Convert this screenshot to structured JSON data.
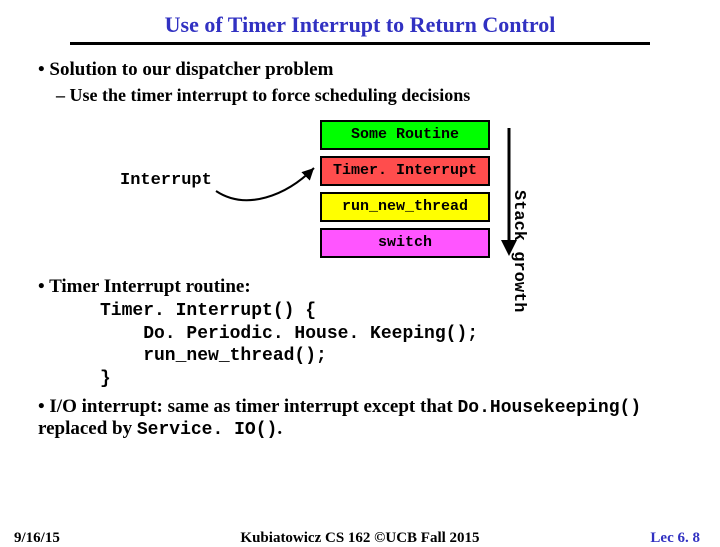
{
  "title": "Use of Timer Interrupt to Return Control",
  "bullets": {
    "b1": "Solution to our dispatcher problem",
    "b1a": "Use the timer interrupt to force scheduling decisions",
    "b2": "Timer Interrupt routine:",
    "b3_pre": "I/O interrupt: same as timer interrupt except that ",
    "b3_code1": "Do.Housekeeping()",
    "b3_mid": " replaced by ",
    "b3_code2": "Service. IO()",
    "b3_end": "."
  },
  "diagram": {
    "interruptLabel": "Interrupt",
    "boxes": {
      "some": "Some Routine",
      "timer": "Timer. Interrupt",
      "run": "run_new_thread",
      "switch": "switch"
    },
    "stackGrowth": "Stack growth"
  },
  "code": "Timer. Interrupt() {\n    Do. Periodic. House. Keeping();\n    run_new_thread();\n}",
  "footer": {
    "date": "9/16/15",
    "mid": "Kubiatowicz CS 162 ©UCB Fall 2015",
    "lec": "Lec 6. 8"
  }
}
